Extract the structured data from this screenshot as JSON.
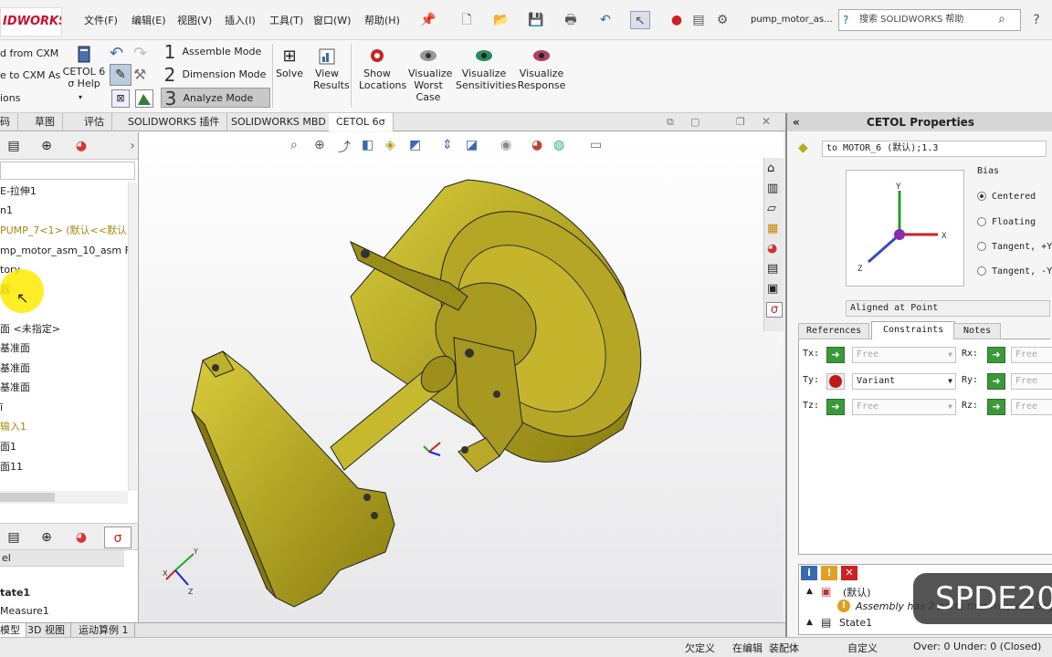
{
  "app": {
    "logo": "SOLIDWORKS",
    "logo_visible": "IDWORKS",
    "menus": [
      "文件(F)",
      "编辑(E)",
      "视图(V)",
      "插入(I)",
      "工具(T)",
      "窗口(W)",
      "帮助(H)"
    ],
    "doc_title": "pump_motor_as...",
    "help_search": "搜索 SOLIDWORKS 帮助"
  },
  "ribbon": {
    "cxm_load": "d from CXM",
    "cxm_save": "e to CXM As",
    "options": "ions",
    "cetol_help": [
      "CETOL 6",
      "σ Help"
    ],
    "modes": [
      {
        "num": "1",
        "label": "Assemble Mode"
      },
      {
        "num": "2",
        "label": "Dimension Mode"
      },
      {
        "num": "3",
        "label": "Analyze Mode"
      }
    ],
    "buttons": [
      {
        "label": "Solve"
      },
      {
        "label": "View Results"
      },
      {
        "label": "Show Locations"
      },
      {
        "label": "Visualize Worst Case"
      },
      {
        "label": "Visualize Sensitivities"
      },
      {
        "label": "Visualize Response"
      }
    ]
  },
  "tabs": [
    "码",
    "草图",
    "评估",
    "SOLIDWORKS 插件",
    "SOLIDWORKS MBD",
    "CETOL 6σ"
  ],
  "tree": [
    "E-拉伸1",
    "n1",
    "PUMP_7<1> (默认<<默认)",
    "mp_motor_asm_10_asm F",
    "tory",
    "器",
    "",
    "面 <未指定>",
    "基准面",
    "基准面",
    "基准面",
    "ī",
    "输入1",
    "面1",
    "面11"
  ],
  "left_lower": {
    "header": "el",
    "state": "tate1",
    "measure": "Measure1"
  },
  "bottom_tabs": [
    "模型",
    "3D 视图",
    "运动算例 1"
  ],
  "status": {
    "s1": "欠定义",
    "s2": "在编辑",
    "s3": "装配体",
    "s4": "自定义",
    "s5": "Over: 0 Under: 0 (Closed)"
  },
  "cetol": {
    "title": "CETOL Properties",
    "constraint_name": "to MOTOR_6 (默认);1.3",
    "bias_label": "Bias",
    "bias_options": [
      "Centered",
      "Floating",
      "Tangent, +Y",
      "Tangent, -Y"
    ],
    "bias_selected": 0,
    "align": "Aligned at Point",
    "tabs": [
      "References",
      "Constraints",
      "Notes"
    ],
    "active_tab": 1,
    "rows": [
      {
        "l": "Tx:",
        "v": "Free",
        "r": "Rx:",
        "rv": "Free"
      },
      {
        "l": "Ty:",
        "v": "Variant",
        "r": "Ry:",
        "rv": "Free"
      },
      {
        "l": "Tz:",
        "v": "Free",
        "r": "Rz:",
        "rv": "Free"
      }
    ],
    "msg_root": "(默认)",
    "msg_text": "Assembly has 2 parts that may not be p",
    "msg_state": "State1"
  },
  "watermark": "SPDE20"
}
